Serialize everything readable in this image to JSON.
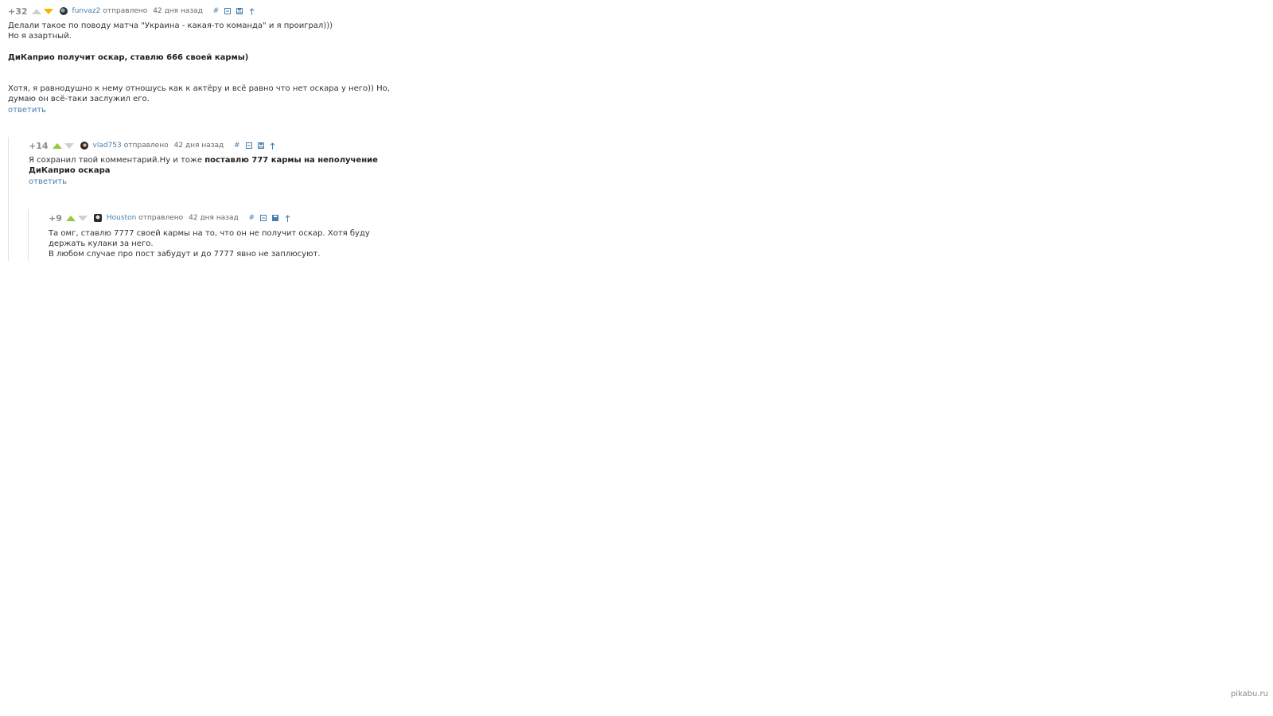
{
  "comments": [
    {
      "rating": "+32",
      "vote_state": "down",
      "avatar_icon": "user-avatar-icon",
      "username": "funvaz2",
      "sent_label": "отправлено",
      "time": "42 дня назад",
      "tools": [
        "#",
        "collapse-icon",
        "save-icon",
        "arrow-up-icon"
      ],
      "text_line1": "Делали такое по поводу матча \"Украина - какая-то команда\" и я проиграл)))",
      "text_line2": "Но я азартный.",
      "bold_line": "ДиКаприо получит оскар, ставлю 666 своей кармы)",
      "text_line3": "Хотя, я равнодушно к нему отношусь как к актёру и всё равно что нет оскара у него)) Но, думаю он всё-таки заслужил его.",
      "reply_label": "ответить"
    },
    {
      "rating": "+14",
      "vote_state": "up",
      "avatar_icon": "user-avatar-icon",
      "username": "vlad753",
      "sent_label": "отправлено",
      "time": "42 дня назад",
      "tools": [
        "#",
        "collapse-icon",
        "save-icon",
        "arrow-up-icon"
      ],
      "text_normal": "Я сохранил твой комментарий.Ну и тоже ",
      "text_bold": "поставлю 777 кармы на неполучение ДиКаприо оскара",
      "reply_label": "ответить"
    },
    {
      "rating": "+9",
      "vote_state": "up",
      "avatar_icon": "user-avatar-icon",
      "username": "Houston",
      "sent_label": "отправлено",
      "time": "42 дня назад",
      "tools": [
        "#",
        "collapse-icon",
        "save-icon",
        "arrow-up-icon"
      ],
      "text_line1": "Та омг, ставлю 7777 своей кармы на то, что он не получит оскар. Хотя буду держать кулаки за него.",
      "text_line2": "В любом случае про пост забудут и до 7777 явно не заплюсуют."
    }
  ],
  "watermark": "pikabu.ru",
  "colors": {
    "link": "#4a7fad",
    "upvote_active": "#94c93d",
    "downvote_active": "#f5b400",
    "vote_inactive": "#cfcfcf"
  }
}
